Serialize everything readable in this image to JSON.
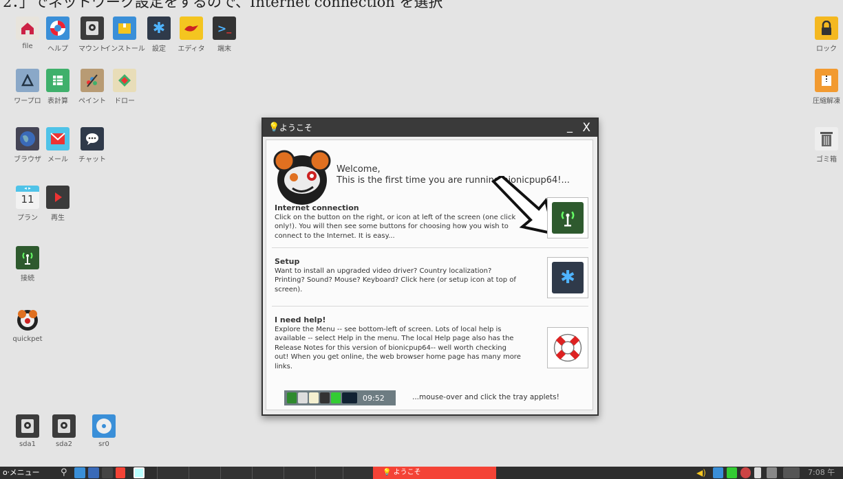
{
  "caption": "2．」でネットワーク設定をするので、Internet connection を選択",
  "desktop": {
    "icons": [
      {
        "name": "file",
        "label": "file",
        "color": "#e8e4dc"
      },
      {
        "name": "help",
        "label": "ヘルプ",
        "color": "#3a8fd8"
      },
      {
        "name": "mount",
        "label": "マウント",
        "color": "#3c3c3c"
      },
      {
        "name": "install",
        "label": "インストール",
        "color": "#3a8fd8"
      },
      {
        "name": "setup",
        "label": "設定",
        "color": "#2f3a4a"
      },
      {
        "name": "editor",
        "label": "エディタ",
        "color": "#f4c520"
      },
      {
        "name": "terminal",
        "label": "端末",
        "color": "#333"
      },
      {
        "name": "wordpro",
        "label": "ワープロ",
        "color": "#8aa8c8"
      },
      {
        "name": "spreadsheet",
        "label": "表計算",
        "color": "#3fb06b"
      },
      {
        "name": "paint",
        "label": "ペイント",
        "color": "#b89b74"
      },
      {
        "name": "draw",
        "label": "ドロー",
        "color": "#e8ddb8"
      },
      {
        "name": "browser",
        "label": "ブラウザ",
        "color": "#445"
      },
      {
        "name": "mail",
        "label": "メール",
        "color": "#4fc3e8"
      },
      {
        "name": "chat",
        "label": "チャット",
        "color": "#2f3a4a"
      },
      {
        "name": "plan",
        "label": "プラン",
        "color": "#f2f2f2"
      },
      {
        "name": "play",
        "label": "再生",
        "color": "#3a3a3a"
      },
      {
        "name": "connect",
        "label": "接続",
        "color": "#2e5a2e"
      },
      {
        "name": "quickpet",
        "label": "quickpet",
        "color": "#e07020"
      },
      {
        "name": "sda1",
        "label": "sda1",
        "color": "#3c3c3c"
      },
      {
        "name": "sda2",
        "label": "sda2",
        "color": "#3c3c3c"
      },
      {
        "name": "sr0",
        "label": "sr0",
        "color": "#3a8fd8"
      },
      {
        "name": "lock",
        "label": "ロック",
        "color": "#f4b820"
      },
      {
        "name": "archive",
        "label": "圧縮解凍",
        "color": "#f29a30"
      },
      {
        "name": "trash",
        "label": "ゴミ箱",
        "color": "#eee"
      }
    ],
    "plan_day": "11"
  },
  "dialog": {
    "title": "ようこそ",
    "min": "_",
    "close": "X",
    "welcome_line1": "Welcome,",
    "welcome_line2": "This is the first time you are running bionicpup64!...",
    "sections": [
      {
        "title": "Internet connection",
        "body": "Click on the button on the right, or icon at left of the screen (one click only!). You will then see some buttons for choosing how you wish to connect to the Internet. It is easy..."
      },
      {
        "title": "Setup",
        "body": "Want to install an upgraded video driver? Country localization? Printing? Sound? Mouse? Keyboard? Click here (or setup icon at top of screen)."
      },
      {
        "title": "I need help!",
        "body": "Explore the Menu -- see bottom-left of screen. Lots of local help is available -- select Help in the menu. The local Help page also has the Release Notes for this version of bionicpup64-- well worth checking out! When you get online, the web browser home page has many more links."
      }
    ],
    "tray_time": "09:52",
    "tray_note": "...mouse-over and click the tray applets!"
  },
  "taskbar": {
    "menu_label": "メニュー",
    "active_task": "ようこそ",
    "clock": "7:08 午"
  },
  "colors": {
    "desktop_bg": "#e4e4e4",
    "taskbar_bg": "#2e2e2e",
    "active_task": "#f44336",
    "titlebar": "#3a3a3a"
  }
}
